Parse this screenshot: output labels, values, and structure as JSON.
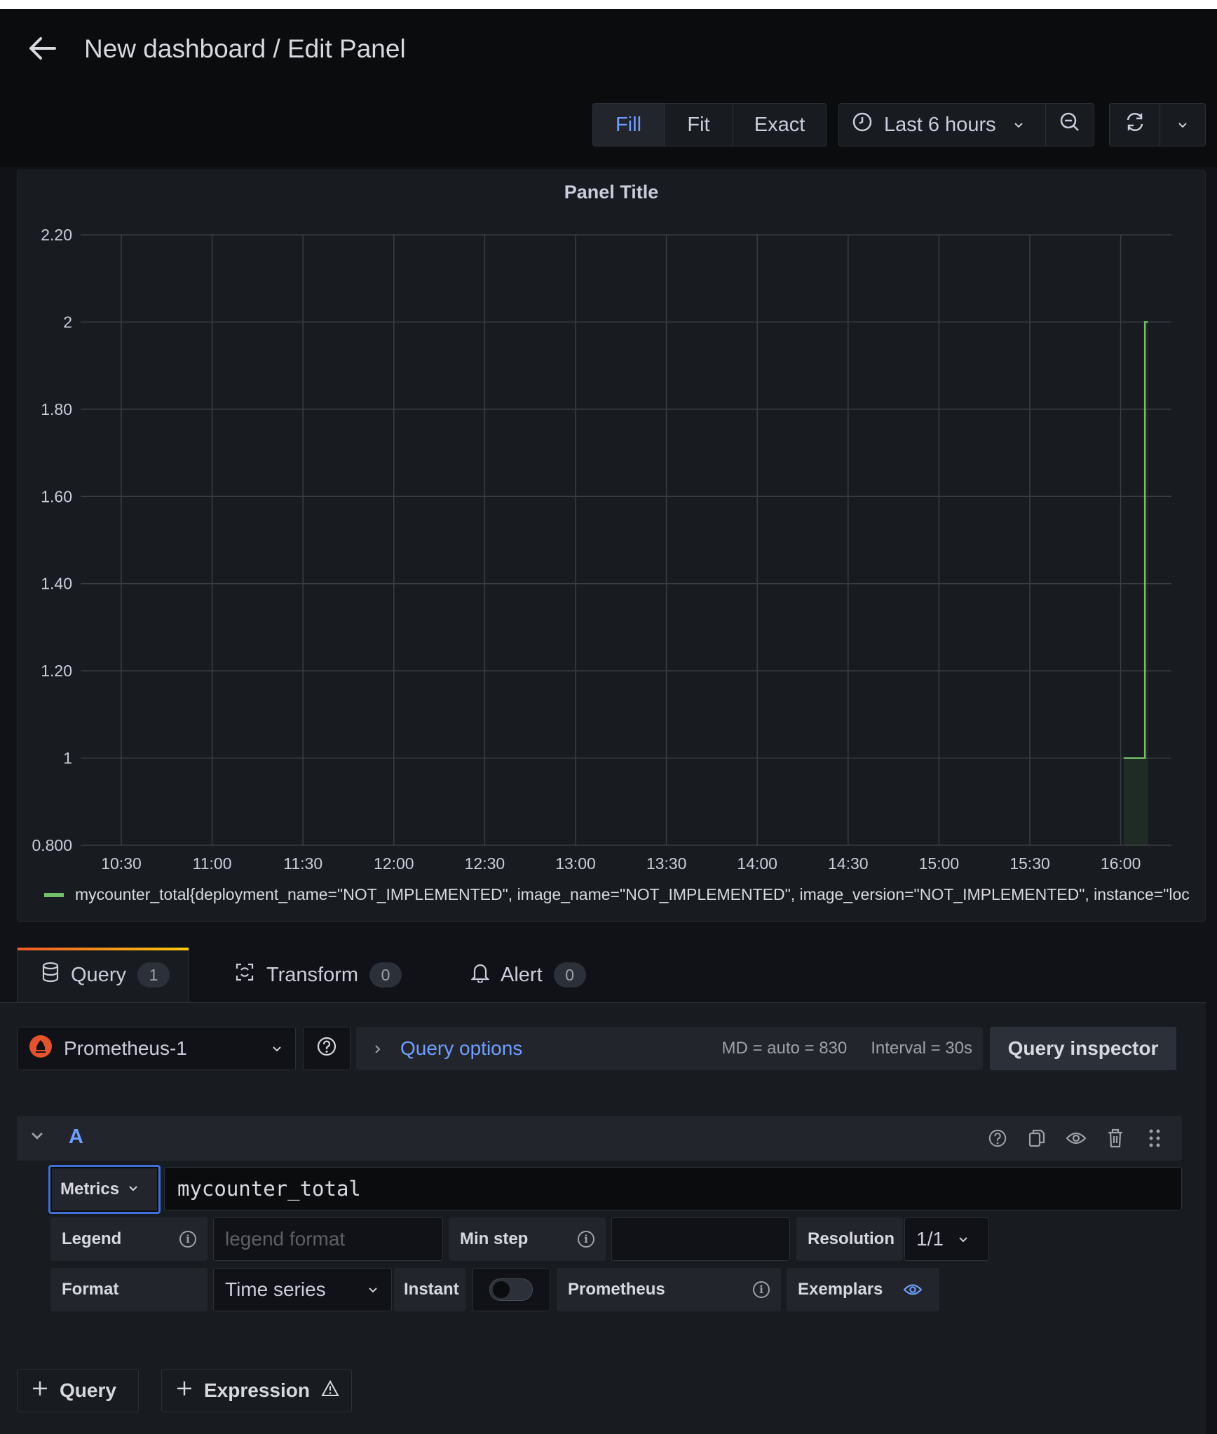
{
  "header": {
    "title": "New dashboard / Edit Panel"
  },
  "toolbar": {
    "fill_label": "Fill",
    "fit_label": "Fit",
    "exact_label": "Exact",
    "time_range": "Last 6 hours"
  },
  "panel": {
    "title": "Panel Title"
  },
  "chart_data": {
    "type": "line",
    "title": "Panel Title",
    "xlabel": "",
    "ylabel": "",
    "x_ticks": [
      "10:30",
      "11:00",
      "11:30",
      "12:00",
      "12:30",
      "13:00",
      "13:30",
      "14:00",
      "14:30",
      "15:00",
      "15:30",
      "16:00"
    ],
    "y_ticks": [
      "0.800",
      "1",
      "1.20",
      "1.40",
      "1.60",
      "1.80",
      "2",
      "2.20"
    ],
    "ylim": [
      0.8,
      2.2
    ],
    "grid": true,
    "legend_position": "bottom-left",
    "series": [
      {
        "name": "mycounter_total{deployment_name=\"NOT_IMPLEMENTED\", image_name=\"NOT_IMPLEMENTED\", image_version=\"NOT_IMPLEMENTED\", instance=\"loc",
        "color": "#73bf69",
        "x": [
          "16:01",
          "16:08",
          "16:08",
          "16:09"
        ],
        "values": [
          1,
          1,
          2,
          2
        ]
      }
    ]
  },
  "tabs": [
    {
      "label": "Query",
      "count": "1"
    },
    {
      "label": "Transform",
      "count": "0"
    },
    {
      "label": "Alert",
      "count": "0"
    }
  ],
  "datasource": {
    "name": "Prometheus-1"
  },
  "query_options": {
    "label": "Query options",
    "md": "MD = auto = 830",
    "interval": "Interval = 30s",
    "inspector_label": "Query inspector"
  },
  "query": {
    "ref_id": "A",
    "metrics_label": "Metrics",
    "expression": "mycounter_total",
    "legend_label": "Legend",
    "legend_placeholder": "legend format",
    "min_step_label": "Min step",
    "min_step_value": "",
    "resolution_label": "Resolution",
    "resolution_value": "1/1",
    "format_label": "Format",
    "format_value": "Time series",
    "instant_label": "Instant",
    "prometheus_label": "Prometheus",
    "exemplars_label": "Exemplars"
  },
  "add_buttons": {
    "query": "Query",
    "expression": "Expression"
  },
  "colors": {
    "accent": "#6e9fff",
    "series": "#73bf69",
    "background": "#111217",
    "panel": "#181b1f"
  }
}
